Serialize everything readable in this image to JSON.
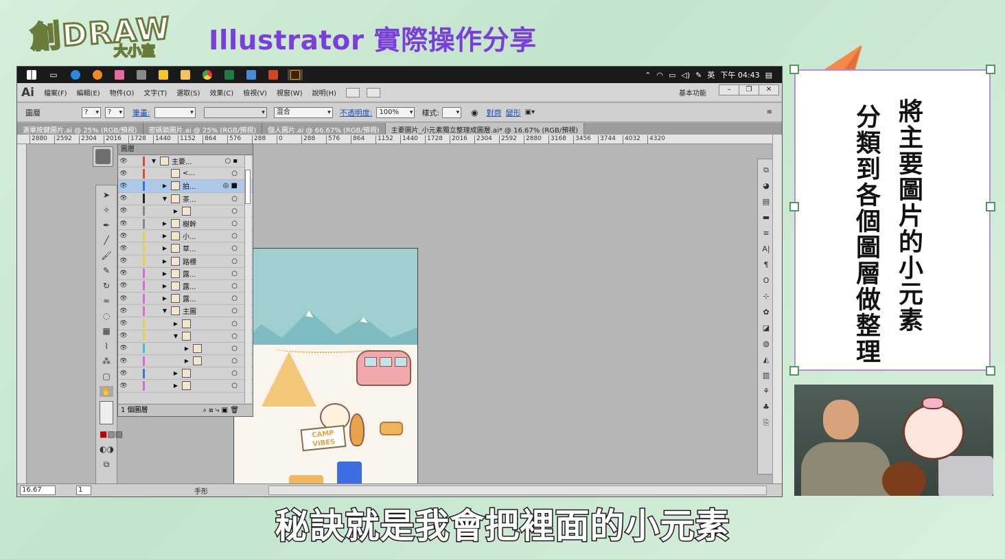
{
  "branding": {
    "logo_line1": "創DRAW",
    "logo_line2": "大小室"
  },
  "headline": "Illustrator 實際操作分享",
  "taskbar": {
    "ime": "英",
    "clock": "下午 04:43"
  },
  "menubar": {
    "app_logo": "Ai",
    "items": [
      "檔案(F)",
      "編輯(E)",
      "物件(O)",
      "文字(T)",
      "選取(S)",
      "效果(C)",
      "檢視(V)",
      "視窗(W)",
      "說明(H)"
    ],
    "workspace": "基本功能"
  },
  "control_bar": {
    "panel_label": "圖層",
    "stroke_label": "筆畫:",
    "blend_mode": "混合",
    "opacity_label": "不透明度:",
    "opacity_value": "100%",
    "style_label": "樣式:",
    "align_label": "對齊",
    "transform_label": "變形"
  },
  "tabs": [
    {
      "label": "選單按鍵圖片.ai @ 25% (RGB/預視)",
      "active": false
    },
    {
      "label": "密碼鎖圖片.ai @ 25% (RGB/預視)",
      "active": false
    },
    {
      "label": "個人圖片.ai @ 66.67% (RGB/預視)",
      "active": false
    },
    {
      "label": "主要圖片_小元素獨立整理成圖層.ai* @ 16.67% (RGB/預視)",
      "active": true
    }
  ],
  "ruler_ticks": [
    "2880",
    "2592",
    "2304",
    "2016",
    "1728",
    "1440",
    "1152",
    "864",
    "576",
    "288",
    "0",
    "288",
    "576",
    "864",
    "1152",
    "1440",
    "1728",
    "2016",
    "2304",
    "2592",
    "2880",
    "3168",
    "3456",
    "3744",
    "4032",
    "4320"
  ],
  "layers_panel": {
    "title": "圖層",
    "rows": [
      {
        "name": "主要...",
        "color": "#e0453a",
        "indent": 0,
        "arrow": "▼",
        "selected": false
      },
      {
        "name": "<...",
        "color": "#e0453a",
        "indent": 1,
        "arrow": "",
        "selected": false
      },
      {
        "name": "拍...",
        "color": "#3d6ee0",
        "indent": 1,
        "arrow": "▶",
        "selected": true
      },
      {
        "name": "茶...",
        "color": "#222222",
        "indent": 1,
        "arrow": "▼",
        "selected": false
      },
      {
        "name": "",
        "color": "#888888",
        "indent": 2,
        "arrow": "▶",
        "selected": false
      },
      {
        "name": "樹幹",
        "color": "#888888",
        "indent": 1,
        "arrow": "▶",
        "selected": false
      },
      {
        "name": "小...",
        "color": "#e6d23a",
        "indent": 1,
        "arrow": "▶",
        "selected": false
      },
      {
        "name": "草...",
        "color": "#e6d23a",
        "indent": 1,
        "arrow": "▶",
        "selected": false
      },
      {
        "name": "路標",
        "color": "#e6d23a",
        "indent": 1,
        "arrow": "▶",
        "selected": false
      },
      {
        "name": "露...",
        "color": "#d86ad6",
        "indent": 1,
        "arrow": "▶",
        "selected": false
      },
      {
        "name": "露...",
        "color": "#d86ad6",
        "indent": 1,
        "arrow": "▶",
        "selected": false
      },
      {
        "name": "露...",
        "color": "#d86ad6",
        "indent": 1,
        "arrow": "▶",
        "selected": false
      },
      {
        "name": "主圖",
        "color": "#d86ad6",
        "indent": 1,
        "arrow": "▼",
        "selected": false
      },
      {
        "name": "",
        "color": "#e6d23a",
        "indent": 2,
        "arrow": "▶",
        "selected": false
      },
      {
        "name": "",
        "color": "#e6d23a",
        "indent": 2,
        "arrow": "▼",
        "selected": false
      },
      {
        "name": "",
        "color": "#3dc0d6",
        "indent": 3,
        "arrow": "▶",
        "selected": false
      },
      {
        "name": "",
        "color": "#d86ad6",
        "indent": 3,
        "arrow": "▶",
        "selected": false
      },
      {
        "name": "",
        "color": "#3d6ee0",
        "indent": 2,
        "arrow": "▶",
        "selected": false
      },
      {
        "name": "",
        "color": "#d86ad6",
        "indent": 2,
        "arrow": "▶",
        "selected": false
      }
    ],
    "footer": "1 個圖層"
  },
  "artwork": {
    "sign_text": "CAMP VIBES"
  },
  "status_bar": {
    "zoom": "16.67",
    "page": "1",
    "tool": "手形"
  },
  "note": {
    "line1": "將主要圖片的小元素",
    "line2": "分類到各個圖層做整理"
  },
  "subtitle": "秘訣就是我會把裡面的小元素",
  "colors": {
    "headline": "#7b3fd9",
    "note_border": "#b68be0",
    "handle_border": "#4a9a5e",
    "arrow": "#f5894a"
  }
}
